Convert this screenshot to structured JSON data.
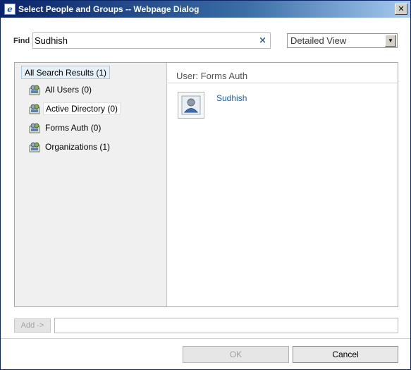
{
  "window": {
    "title": "Select People and Groups -- Webpage Dialog",
    "close_glyph": "✕",
    "app_icon": "ie-icon"
  },
  "find": {
    "label": "Find",
    "value": "Sudhish",
    "clear_glyph": "×"
  },
  "view": {
    "selected": "Detailed View",
    "arrow": "▼"
  },
  "tree": {
    "root": "All Search Results (1)",
    "items": [
      {
        "label": "All Users (0)",
        "icon": "directory-users-icon"
      },
      {
        "label": "Active Directory (0)",
        "icon": "directory-users-icon"
      },
      {
        "label": "Forms Auth (0)",
        "icon": "directory-users-icon"
      },
      {
        "label": "Organizations (1)",
        "icon": "directory-users-icon"
      }
    ]
  },
  "results": {
    "group_header": "User: Forms Auth",
    "items": [
      {
        "name": "Sudhish",
        "icon": "user-avatar-icon"
      }
    ]
  },
  "add": {
    "button_label": "Add ->",
    "field_value": ""
  },
  "footer": {
    "ok_label": "OK",
    "cancel_label": "Cancel"
  },
  "colors": {
    "title_bar": "#0a246a",
    "link": "#1e5aa8",
    "tree_selected_bg": "#e6f0fb",
    "left_pane_bg": "#f0f0f0"
  }
}
